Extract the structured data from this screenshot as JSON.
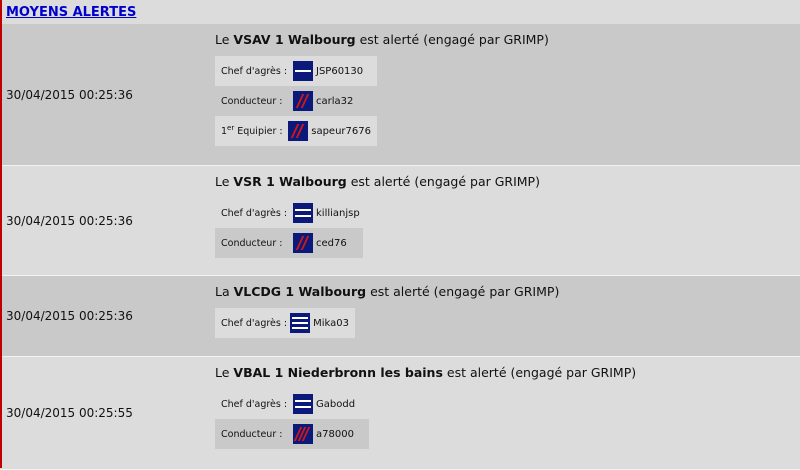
{
  "header": {
    "title": "MOYENS ALERTES"
  },
  "alerts": [
    {
      "timestamp": "30/04/2015 00:25:36",
      "prefix": "Le",
      "vehicle": "VSAV 1 Walbourg",
      "suffix": "est alerté (engagé par GRIMP)",
      "crew": [
        {
          "role": "Chef d'agrès :",
          "user": "JSP60130",
          "icon": "jsp-rank-icon"
        },
        {
          "role": "Conducteur :",
          "user": "carla32",
          "icon": "caporal-rank-icon"
        },
        {
          "role_sup": "er",
          "role_pre": "1",
          "role_post": " Equipier :",
          "user": "sapeur7676",
          "icon": "caporal-rank-icon"
        }
      ]
    },
    {
      "timestamp": "30/04/2015 00:25:36",
      "prefix": "Le",
      "vehicle": "VSR 1 Walbourg",
      "suffix": "est alerté (engagé par GRIMP)",
      "crew": [
        {
          "role": "Chef d'agrès :",
          "user": "killianjsp",
          "icon": "sergent-rank-icon"
        },
        {
          "role": "Conducteur :",
          "user": "ced76",
          "icon": "caporal-rank-icon"
        }
      ]
    },
    {
      "timestamp": "30/04/2015 00:25:36",
      "prefix": "La",
      "vehicle": "VLCDG 1 Walbourg",
      "suffix": "est alerté (engagé par GRIMP)",
      "crew": [
        {
          "role": "Chef d'agrès :",
          "user": "Mika03",
          "icon": "adjudant-rank-icon"
        }
      ]
    },
    {
      "timestamp": "30/04/2015 00:25:55",
      "prefix": "Le",
      "vehicle": "VBAL 1 Niederbronn les bains",
      "suffix": "est alerté (engagé par GRIMP)",
      "crew": [
        {
          "role": "Chef d'agrès :",
          "user": "Gabodd",
          "icon": "sergent-rank-icon"
        },
        {
          "role": "Conducteur :",
          "user": "a78000",
          "icon": "caporal-chef-rank-icon"
        }
      ]
    }
  ]
}
